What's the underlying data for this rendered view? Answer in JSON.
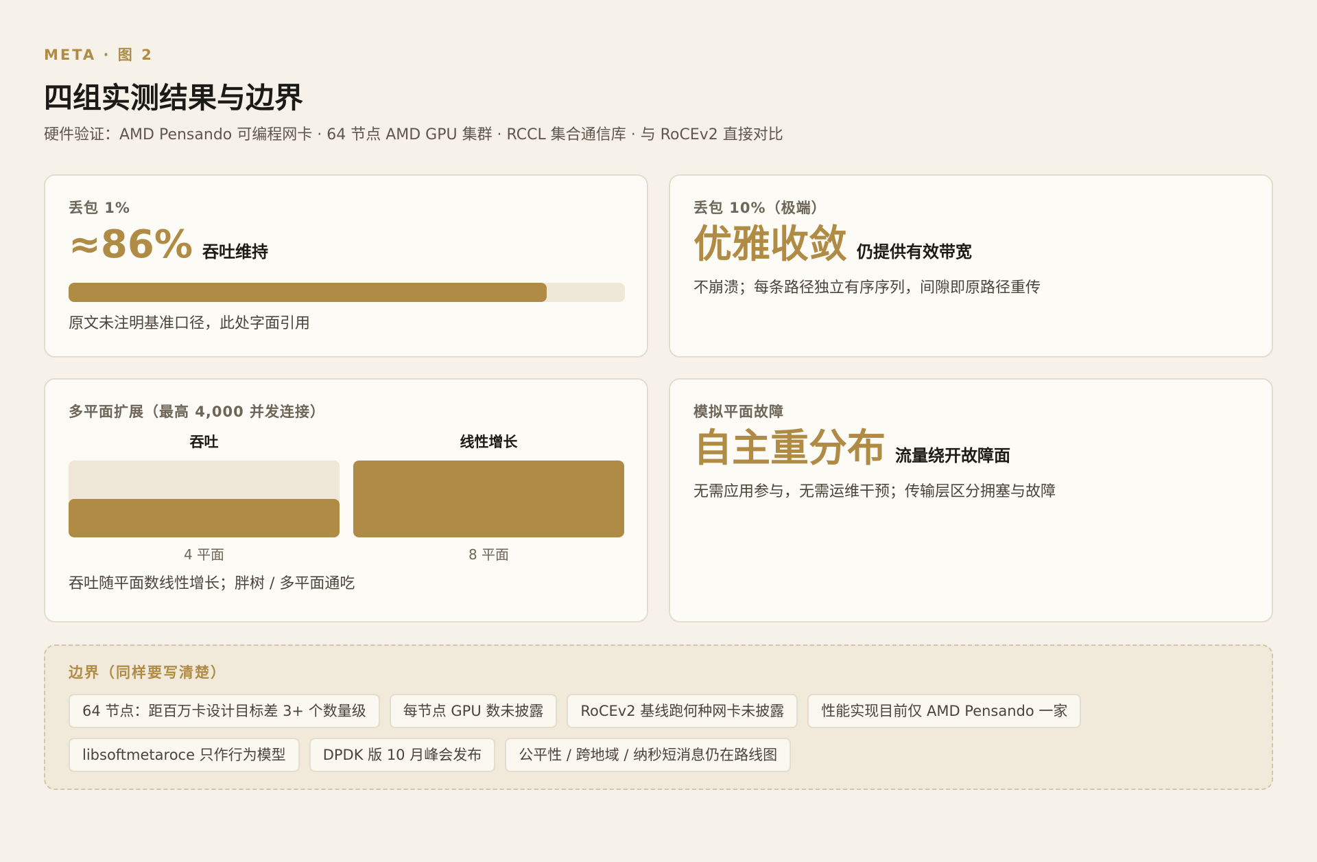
{
  "header": {
    "eyebrow": "META · 图 2",
    "title": "四组实测结果与边界",
    "subtitle": "硬件验证：AMD Pensando 可编程网卡 · 64 节点 AMD GPU 集群 · RCCL 集合通信库 · 与 RoCEv2 直接对比"
  },
  "cards": [
    {
      "label": "丢包 1%",
      "big": "≈86%",
      "suffix": "吞吐维持",
      "progress": 0.86,
      "note": "原文未注明基准口径，此处字面引用"
    },
    {
      "label": "丢包 10%（极端）",
      "big": "优雅收敛",
      "suffix": "仍提供有效带宽",
      "note": "不崩溃；每条路径独立有序序列，间隙即原路径重传"
    },
    {
      "label": "多平面扩展（最高 4,000 并发连接）",
      "columns": [
        {
          "head": "吞吐",
          "foot": "4 平面",
          "level": 0.5
        },
        {
          "head": "线性增长",
          "foot": "8 平面",
          "level": 1.0
        }
      ],
      "note": "吞吐随平面数线性增长；胖树 / 多平面通吃"
    },
    {
      "label": "模拟平面故障",
      "big": "自主重分布",
      "suffix": "流量绕开故障面",
      "note": "无需应用参与，无需运维干预；传输层区分拥塞与故障"
    }
  ],
  "boundaries": {
    "label": "边界（同样要写清楚）",
    "chips": [
      "64 节点：距百万卡设计目标差 3+ 个数量级",
      "每节点 GPU 数未披露",
      "RoCEv2 基线跑何种网卡未披露",
      "性能实现目前仅 AMD Pensando 一家",
      "libsoftmetaroce 只作行为模型",
      "DPDK 版 10 月峰会发布",
      "公平性 / 跨地域 / 纳秒短消息仍在路线图"
    ]
  },
  "colors": {
    "accent": "#b08b45",
    "track": "#efe8d9",
    "background": "#f6f2e9"
  }
}
